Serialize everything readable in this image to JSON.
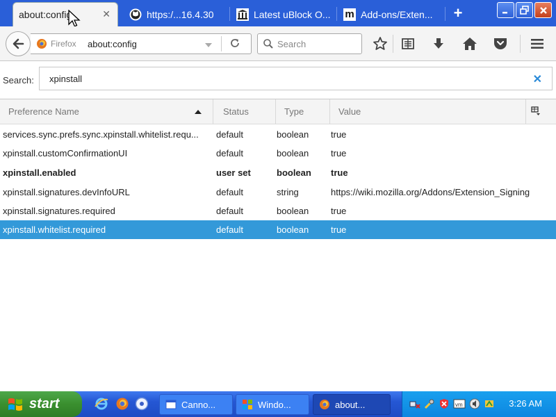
{
  "window": {
    "tabs": [
      {
        "label": "about:config",
        "icon": "document-icon",
        "active": true
      },
      {
        "label": "https:/...16.4.30",
        "icon": "github-icon"
      },
      {
        "label": "Latest uBlock O...",
        "icon": "library-icon"
      },
      {
        "label": "Add-ons/Exten...",
        "icon": "mdn-icon"
      }
    ],
    "new_tab_label": "+"
  },
  "navbar": {
    "identity_label": "Firefox",
    "url": "about:config",
    "search_placeholder": "Search"
  },
  "filter": {
    "label": "Search:",
    "value": "xpinstall"
  },
  "table": {
    "columns": [
      "Preference Name",
      "Status",
      "Type",
      "Value"
    ],
    "sort_column": "Preference Name",
    "sort_direction": "ascending",
    "rows": [
      {
        "name": "services.sync.prefs.sync.xpinstall.whitelist.requ...",
        "status": "default",
        "type": "boolean",
        "value": "true"
      },
      {
        "name": "xpinstall.customConfirmationUI",
        "status": "default",
        "type": "boolean",
        "value": "true"
      },
      {
        "name": "xpinstall.enabled",
        "status": "user set",
        "type": "boolean",
        "value": "true",
        "bold": true
      },
      {
        "name": "xpinstall.signatures.devInfoURL",
        "status": "default",
        "type": "string",
        "value": "https://wiki.mozilla.org/Addons/Extension_Signing"
      },
      {
        "name": "xpinstall.signatures.required",
        "status": "default",
        "type": "boolean",
        "value": "true"
      },
      {
        "name": "xpinstall.whitelist.required",
        "status": "default",
        "type": "boolean",
        "value": "true",
        "selected": true
      }
    ]
  },
  "taskbar": {
    "start_label": "start",
    "tasks": [
      {
        "label": "Canno...",
        "icon": "window-icon"
      },
      {
        "label": "Windo...",
        "icon": "windows-icon"
      },
      {
        "label": "about...",
        "icon": "firefox-icon",
        "active": true
      }
    ],
    "clock": "3:26 AM"
  },
  "colors": {
    "selection": "#3399d9",
    "tabbar": "#2a5fd8",
    "taskbar": "#2557d4",
    "start_button": "#3a8f2f"
  }
}
